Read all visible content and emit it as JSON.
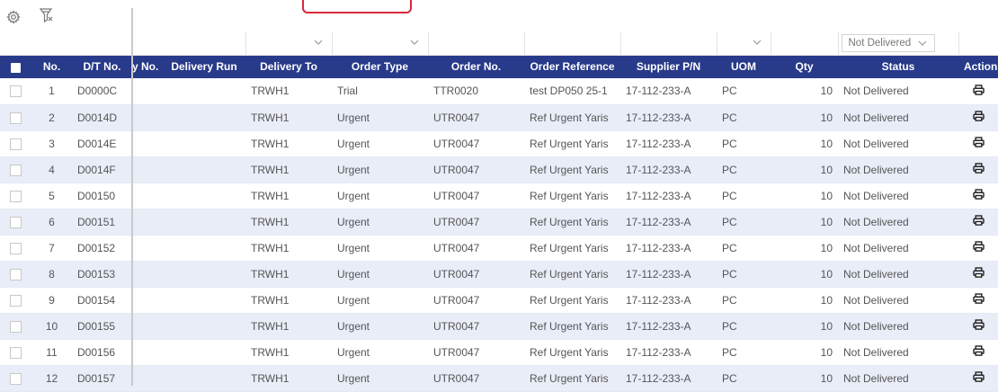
{
  "toolbar": {
    "icons": [
      "gear-icon",
      "filter-clear-icon",
      "filter-icon",
      "filter-active-icon"
    ]
  },
  "filters": {
    "status_selected": "Not Delivered"
  },
  "columns": {
    "no": "No.",
    "dt_no": "D/T No.",
    "clipped": "y No.",
    "delivery_run": "Delivery Run",
    "delivery_to": "Delivery To",
    "order_type": "Order Type",
    "order_no": "Order No.",
    "order_reference": "Order Reference",
    "supplier_pn": "Supplier P/N",
    "uom": "UOM",
    "qty": "Qty",
    "status": "Status",
    "action": "Action"
  },
  "rows": [
    {
      "no": "1",
      "dt": "D0000C",
      "to": "TRWH1",
      "type": "Trial",
      "order": "TTR0020",
      "ref": "test DP050 25-1",
      "pn": "17-112-233-A",
      "uom": "PC",
      "qty": "10",
      "status": "Not Delivered"
    },
    {
      "no": "2",
      "dt": "D0014D",
      "to": "TRWH1",
      "type": "Urgent",
      "order": "UTR0047",
      "ref": "Ref Urgent Yaris",
      "pn": "17-112-233-A",
      "uom": "PC",
      "qty": "10",
      "status": "Not Delivered"
    },
    {
      "no": "3",
      "dt": "D0014E",
      "to": "TRWH1",
      "type": "Urgent",
      "order": "UTR0047",
      "ref": "Ref Urgent Yaris",
      "pn": "17-112-233-A",
      "uom": "PC",
      "qty": "10",
      "status": "Not Delivered"
    },
    {
      "no": "4",
      "dt": "D0014F",
      "to": "TRWH1",
      "type": "Urgent",
      "order": "UTR0047",
      "ref": "Ref Urgent Yaris",
      "pn": "17-112-233-A",
      "uom": "PC",
      "qty": "10",
      "status": "Not Delivered"
    },
    {
      "no": "5",
      "dt": "D00150",
      "to": "TRWH1",
      "type": "Urgent",
      "order": "UTR0047",
      "ref": "Ref Urgent Yaris",
      "pn": "17-112-233-A",
      "uom": "PC",
      "qty": "10",
      "status": "Not Delivered"
    },
    {
      "no": "6",
      "dt": "D00151",
      "to": "TRWH1",
      "type": "Urgent",
      "order": "UTR0047",
      "ref": "Ref Urgent Yaris",
      "pn": "17-112-233-A",
      "uom": "PC",
      "qty": "10",
      "status": "Not Delivered"
    },
    {
      "no": "7",
      "dt": "D00152",
      "to": "TRWH1",
      "type": "Urgent",
      "order": "UTR0047",
      "ref": "Ref Urgent Yaris",
      "pn": "17-112-233-A",
      "uom": "PC",
      "qty": "10",
      "status": "Not Delivered"
    },
    {
      "no": "8",
      "dt": "D00153",
      "to": "TRWH1",
      "type": "Urgent",
      "order": "UTR0047",
      "ref": "Ref Urgent Yaris",
      "pn": "17-112-233-A",
      "uom": "PC",
      "qty": "10",
      "status": "Not Delivered"
    },
    {
      "no": "9",
      "dt": "D00154",
      "to": "TRWH1",
      "type": "Urgent",
      "order": "UTR0047",
      "ref": "Ref Urgent Yaris",
      "pn": "17-112-233-A",
      "uom": "PC",
      "qty": "10",
      "status": "Not Delivered"
    },
    {
      "no": "10",
      "dt": "D00155",
      "to": "TRWH1",
      "type": "Urgent",
      "order": "UTR0047",
      "ref": "Ref Urgent Yaris",
      "pn": "17-112-233-A",
      "uom": "PC",
      "qty": "10",
      "status": "Not Delivered"
    },
    {
      "no": "11",
      "dt": "D00156",
      "to": "TRWH1",
      "type": "Urgent",
      "order": "UTR0047",
      "ref": "Ref Urgent Yaris",
      "pn": "17-112-233-A",
      "uom": "PC",
      "qty": "10",
      "status": "Not Delivered"
    },
    {
      "no": "12",
      "dt": "D00157",
      "to": "TRWH1",
      "type": "Urgent",
      "order": "UTR0047",
      "ref": "Ref Urgent Yaris",
      "pn": "17-112-233-A",
      "uom": "PC",
      "qty": "10",
      "status": "Not Delivered"
    }
  ],
  "colors": {
    "header_bg": "#283a8a",
    "alt_row_bg": "#e9edf8",
    "highlight_box": "#d8283c"
  }
}
